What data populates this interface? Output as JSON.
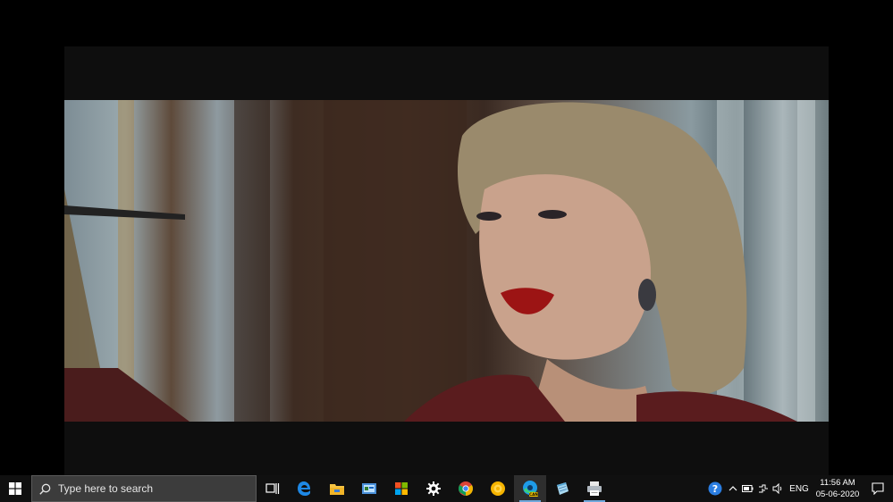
{
  "taskbar": {
    "search_placeholder": "Type here to search",
    "language": "ENG",
    "time": "11:56 AM",
    "date": "05-06-2020",
    "pinned_apps": [
      {
        "name": "task-view-icon"
      },
      {
        "name": "edge-legacy-icon"
      },
      {
        "name": "file-explorer-icon"
      },
      {
        "name": "control-panel-icon"
      },
      {
        "name": "microsoft-store-icon"
      },
      {
        "name": "settings-icon"
      },
      {
        "name": "chrome-icon"
      },
      {
        "name": "yellow-app-icon"
      },
      {
        "name": "edge-canary-icon",
        "badge": "CAN"
      },
      {
        "name": "notepad-icon"
      },
      {
        "name": "printer-icon"
      }
    ],
    "tray_icons": [
      "help-icon",
      "chevron-up-icon",
      "battery-icon",
      "network-icon",
      "volume-icon"
    ]
  },
  "colors": {
    "taskbar_bg": "#101010",
    "search_bg": "#3c3c3c",
    "accent": "#6fa8dc"
  }
}
